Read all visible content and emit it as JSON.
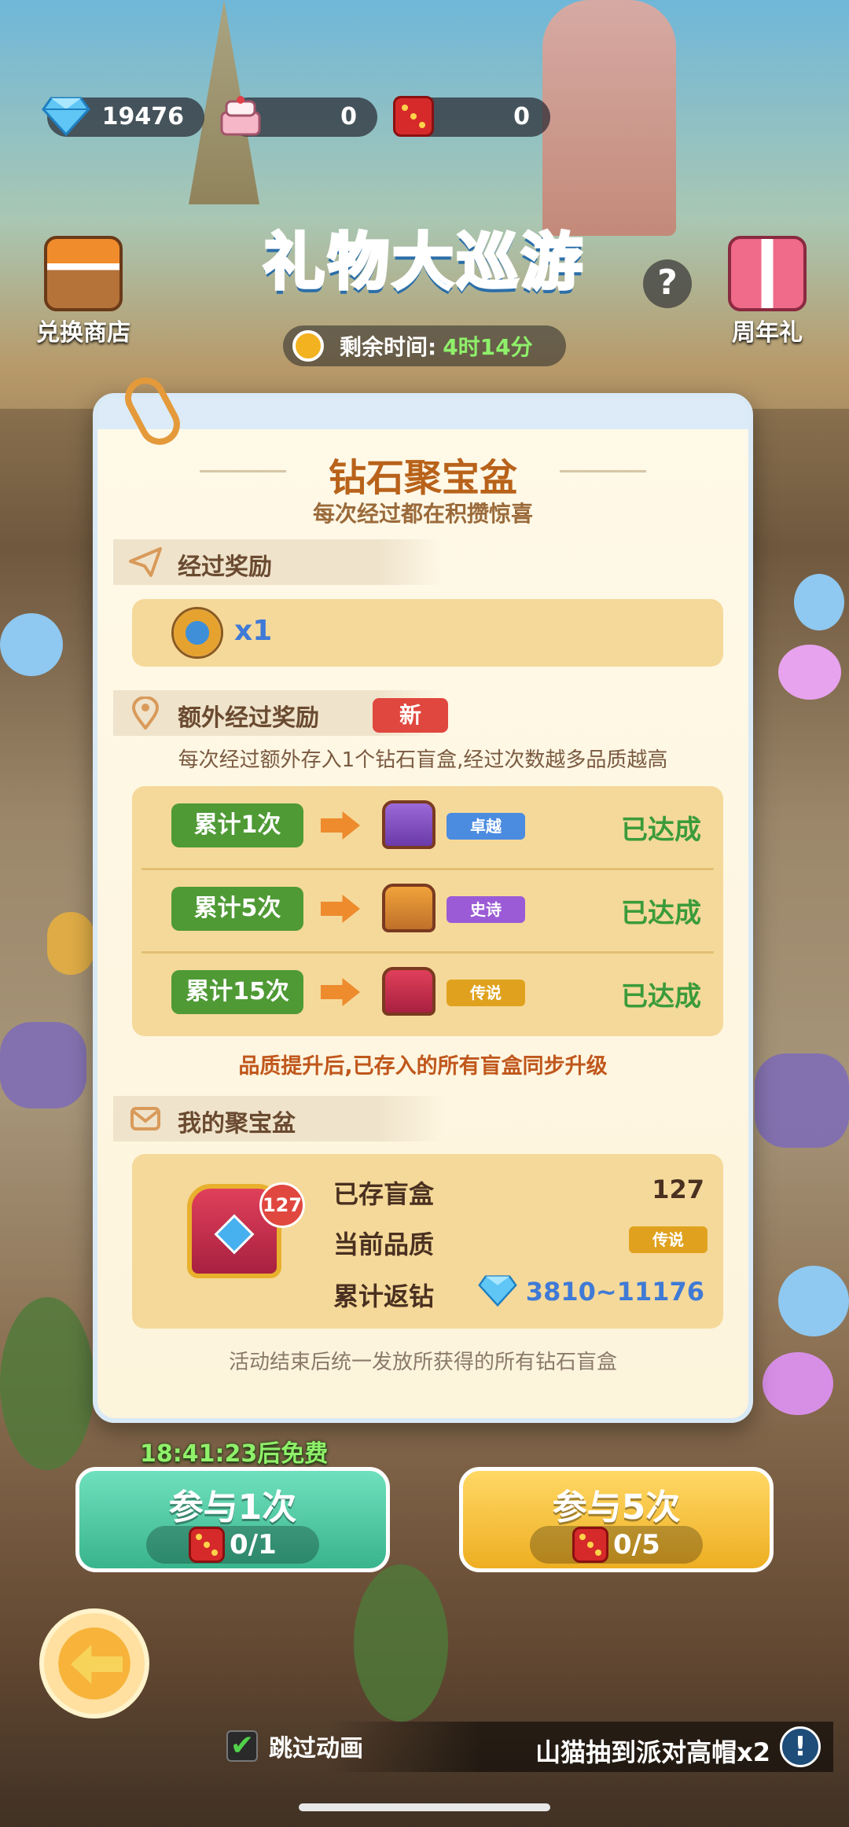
{
  "currency": {
    "diamonds": "19476",
    "cake": "0",
    "dice": "0"
  },
  "header": {
    "title": "礼物大巡游",
    "shop_label": "兑换商店",
    "anniversary_label": "周年礼",
    "help_glyph": "?",
    "timer_label": "剩余时间:",
    "timer_value": "4时14分"
  },
  "modal": {
    "title": "钻石聚宝盆",
    "subtitle": "每次经过都在积攒惊喜",
    "pass_reward": {
      "heading": "经过奖励",
      "item_icon": "compass-icon",
      "quantity": "x1"
    },
    "extra_reward": {
      "heading": "额外经过奖励",
      "new_badge": "新",
      "description": "每次经过额外存入1个钻石盲盒,经过次数越多品质越高",
      "tiers": [
        {
          "count": "累计1次",
          "quality": "卓越",
          "status": "已达成",
          "quality_color": "#4b8be0"
        },
        {
          "count": "累计5次",
          "quality": "史诗",
          "status": "已达成",
          "quality_color": "#9b5bd6"
        },
        {
          "count": "累计15次",
          "quality": "传说",
          "status": "已达成",
          "quality_color": "#e0a21e"
        }
      ],
      "note": "品质提升后,已存入的所有盲盒同步升级"
    },
    "my_pot": {
      "heading": "我的聚宝盆",
      "badge_count": "127",
      "stored_label": "已存盲盒",
      "stored_value": "127",
      "quality_label": "当前品质",
      "quality_value": "传说",
      "return_label": "累计返钻",
      "return_value": "3810~11176"
    },
    "footer": "活动结束后统一发放所获得的所有钻石盲盒"
  },
  "actions": {
    "free_timer": "18:41:23后免费",
    "join_one": {
      "label": "参与1次",
      "cost": "0/1"
    },
    "join_five": {
      "label": "参与5次",
      "cost": "0/5"
    },
    "skip_label": "跳过动画",
    "skip_checked": true,
    "ticker": "山猫抽到派对高帽x2",
    "info_glyph": "!"
  },
  "colors": {
    "accent_orange": "#b8621a",
    "success_green": "#3b9b3a",
    "join_one_bg": "#49c9a0",
    "join_five_bg": "#f2c03a"
  }
}
